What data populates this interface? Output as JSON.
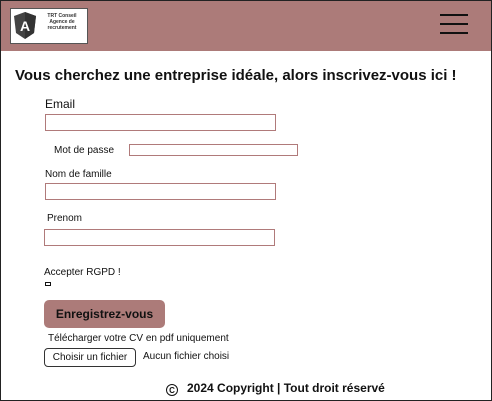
{
  "header": {
    "logo_text": "TRT Conseil Agence de recrutement",
    "logo_letter": "A",
    "menu_icon": "hamburger-menu-icon",
    "background_color": "#ac7b79"
  },
  "main": {
    "headline": "Vous cherchez une entreprise idéale, alors inscrivez-vous ici !"
  },
  "form": {
    "email_label": "Email",
    "email_value": "",
    "password_label": "Mot de passe",
    "password_value": "",
    "lastname_label": "Nom de famille",
    "lastname_value": "",
    "firstname_label": "Prenom",
    "firstname_value": "",
    "rgpd_label": "Accepter RGPD !",
    "submit_label": "Enregistrez-vous",
    "cv_label": "Télécharger votre CV en pdf uniquement",
    "file_button_label": "Choisir un fichier",
    "file_status": "Aucun fichier choisi"
  },
  "footer": {
    "copyright_symbol": "C",
    "text": "2024 Copyright | Tout droit réservé"
  },
  "colors": {
    "accent": "#ac7b79",
    "input_border": "#b07a7a"
  }
}
